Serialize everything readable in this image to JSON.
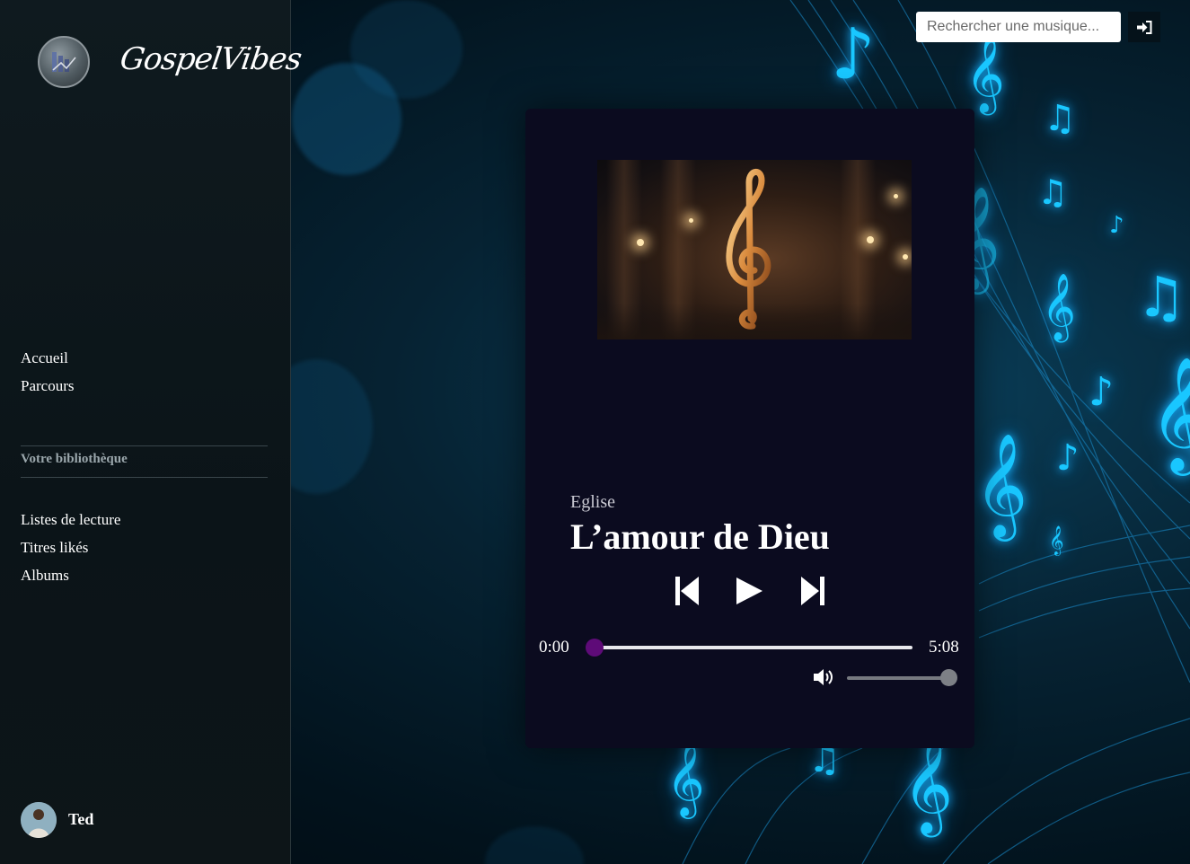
{
  "app": {
    "brand": "GospelVibes"
  },
  "sidebar": {
    "nav": [
      {
        "label": "Accueil"
      },
      {
        "label": "Parcours"
      }
    ],
    "library_title": "Votre bibliothèque",
    "library": [
      {
        "label": "Listes de lecture"
      },
      {
        "label": "Titres likés"
      },
      {
        "label": "Albums"
      }
    ],
    "user": {
      "name": "Ted"
    }
  },
  "search": {
    "placeholder": "Rechercher une musique...",
    "value": ""
  },
  "header": {
    "login_icon": "sign-in-icon"
  },
  "player": {
    "genre": "Eglise",
    "title": "L’amour de Dieu",
    "current_time": "0:00",
    "duration": "5:08",
    "progress": 0.0,
    "volume": 1.0,
    "controls": {
      "prev_icon": "skip-previous-icon",
      "play_icon": "play-icon",
      "next_icon": "skip-next-icon",
      "volume_icon": "volume-icon"
    }
  },
  "colors": {
    "accent": "#5e0b78",
    "card_bg": "#0b0b1f",
    "sidebar_bg": "#0f1a1f",
    "note_glow": "#19c7ff"
  }
}
